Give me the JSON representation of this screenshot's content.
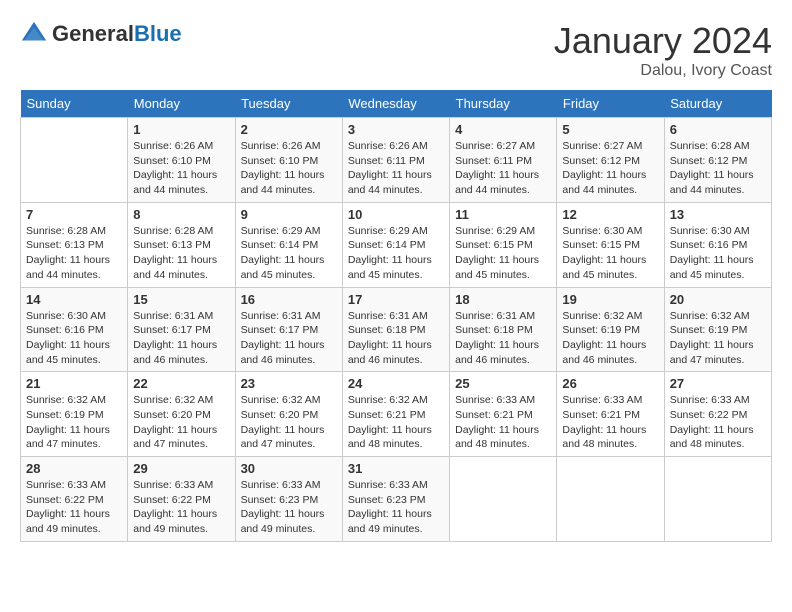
{
  "logo": {
    "general": "General",
    "blue": "Blue"
  },
  "header": {
    "month": "January 2024",
    "location": "Dalou, Ivory Coast"
  },
  "weekdays": [
    "Sunday",
    "Monday",
    "Tuesday",
    "Wednesday",
    "Thursday",
    "Friday",
    "Saturday"
  ],
  "weeks": [
    [
      {
        "day": "",
        "sunrise": "",
        "sunset": "",
        "daylight": ""
      },
      {
        "day": "1",
        "sunrise": "Sunrise: 6:26 AM",
        "sunset": "Sunset: 6:10 PM",
        "daylight": "Daylight: 11 hours and 44 minutes."
      },
      {
        "day": "2",
        "sunrise": "Sunrise: 6:26 AM",
        "sunset": "Sunset: 6:10 PM",
        "daylight": "Daylight: 11 hours and 44 minutes."
      },
      {
        "day": "3",
        "sunrise": "Sunrise: 6:26 AM",
        "sunset": "Sunset: 6:11 PM",
        "daylight": "Daylight: 11 hours and 44 minutes."
      },
      {
        "day": "4",
        "sunrise": "Sunrise: 6:27 AM",
        "sunset": "Sunset: 6:11 PM",
        "daylight": "Daylight: 11 hours and 44 minutes."
      },
      {
        "day": "5",
        "sunrise": "Sunrise: 6:27 AM",
        "sunset": "Sunset: 6:12 PM",
        "daylight": "Daylight: 11 hours and 44 minutes."
      },
      {
        "day": "6",
        "sunrise": "Sunrise: 6:28 AM",
        "sunset": "Sunset: 6:12 PM",
        "daylight": "Daylight: 11 hours and 44 minutes."
      }
    ],
    [
      {
        "day": "7",
        "sunrise": "Sunrise: 6:28 AM",
        "sunset": "Sunset: 6:13 PM",
        "daylight": "Daylight: 11 hours and 44 minutes."
      },
      {
        "day": "8",
        "sunrise": "Sunrise: 6:28 AM",
        "sunset": "Sunset: 6:13 PM",
        "daylight": "Daylight: 11 hours and 44 minutes."
      },
      {
        "day": "9",
        "sunrise": "Sunrise: 6:29 AM",
        "sunset": "Sunset: 6:14 PM",
        "daylight": "Daylight: 11 hours and 45 minutes."
      },
      {
        "day": "10",
        "sunrise": "Sunrise: 6:29 AM",
        "sunset": "Sunset: 6:14 PM",
        "daylight": "Daylight: 11 hours and 45 minutes."
      },
      {
        "day": "11",
        "sunrise": "Sunrise: 6:29 AM",
        "sunset": "Sunset: 6:15 PM",
        "daylight": "Daylight: 11 hours and 45 minutes."
      },
      {
        "day": "12",
        "sunrise": "Sunrise: 6:30 AM",
        "sunset": "Sunset: 6:15 PM",
        "daylight": "Daylight: 11 hours and 45 minutes."
      },
      {
        "day": "13",
        "sunrise": "Sunrise: 6:30 AM",
        "sunset": "Sunset: 6:16 PM",
        "daylight": "Daylight: 11 hours and 45 minutes."
      }
    ],
    [
      {
        "day": "14",
        "sunrise": "Sunrise: 6:30 AM",
        "sunset": "Sunset: 6:16 PM",
        "daylight": "Daylight: 11 hours and 45 minutes."
      },
      {
        "day": "15",
        "sunrise": "Sunrise: 6:31 AM",
        "sunset": "Sunset: 6:17 PM",
        "daylight": "Daylight: 11 hours and 46 minutes."
      },
      {
        "day": "16",
        "sunrise": "Sunrise: 6:31 AM",
        "sunset": "Sunset: 6:17 PM",
        "daylight": "Daylight: 11 hours and 46 minutes."
      },
      {
        "day": "17",
        "sunrise": "Sunrise: 6:31 AM",
        "sunset": "Sunset: 6:18 PM",
        "daylight": "Daylight: 11 hours and 46 minutes."
      },
      {
        "day": "18",
        "sunrise": "Sunrise: 6:31 AM",
        "sunset": "Sunset: 6:18 PM",
        "daylight": "Daylight: 11 hours and 46 minutes."
      },
      {
        "day": "19",
        "sunrise": "Sunrise: 6:32 AM",
        "sunset": "Sunset: 6:19 PM",
        "daylight": "Daylight: 11 hours and 46 minutes."
      },
      {
        "day": "20",
        "sunrise": "Sunrise: 6:32 AM",
        "sunset": "Sunset: 6:19 PM",
        "daylight": "Daylight: 11 hours and 47 minutes."
      }
    ],
    [
      {
        "day": "21",
        "sunrise": "Sunrise: 6:32 AM",
        "sunset": "Sunset: 6:19 PM",
        "daylight": "Daylight: 11 hours and 47 minutes."
      },
      {
        "day": "22",
        "sunrise": "Sunrise: 6:32 AM",
        "sunset": "Sunset: 6:20 PM",
        "daylight": "Daylight: 11 hours and 47 minutes."
      },
      {
        "day": "23",
        "sunrise": "Sunrise: 6:32 AM",
        "sunset": "Sunset: 6:20 PM",
        "daylight": "Daylight: 11 hours and 47 minutes."
      },
      {
        "day": "24",
        "sunrise": "Sunrise: 6:32 AM",
        "sunset": "Sunset: 6:21 PM",
        "daylight": "Daylight: 11 hours and 48 minutes."
      },
      {
        "day": "25",
        "sunrise": "Sunrise: 6:33 AM",
        "sunset": "Sunset: 6:21 PM",
        "daylight": "Daylight: 11 hours and 48 minutes."
      },
      {
        "day": "26",
        "sunrise": "Sunrise: 6:33 AM",
        "sunset": "Sunset: 6:21 PM",
        "daylight": "Daylight: 11 hours and 48 minutes."
      },
      {
        "day": "27",
        "sunrise": "Sunrise: 6:33 AM",
        "sunset": "Sunset: 6:22 PM",
        "daylight": "Daylight: 11 hours and 48 minutes."
      }
    ],
    [
      {
        "day": "28",
        "sunrise": "Sunrise: 6:33 AM",
        "sunset": "Sunset: 6:22 PM",
        "daylight": "Daylight: 11 hours and 49 minutes."
      },
      {
        "day": "29",
        "sunrise": "Sunrise: 6:33 AM",
        "sunset": "Sunset: 6:22 PM",
        "daylight": "Daylight: 11 hours and 49 minutes."
      },
      {
        "day": "30",
        "sunrise": "Sunrise: 6:33 AM",
        "sunset": "Sunset: 6:23 PM",
        "daylight": "Daylight: 11 hours and 49 minutes."
      },
      {
        "day": "31",
        "sunrise": "Sunrise: 6:33 AM",
        "sunset": "Sunset: 6:23 PM",
        "daylight": "Daylight: 11 hours and 49 minutes."
      },
      {
        "day": "",
        "sunrise": "",
        "sunset": "",
        "daylight": ""
      },
      {
        "day": "",
        "sunrise": "",
        "sunset": "",
        "daylight": ""
      },
      {
        "day": "",
        "sunrise": "",
        "sunset": "",
        "daylight": ""
      }
    ]
  ]
}
